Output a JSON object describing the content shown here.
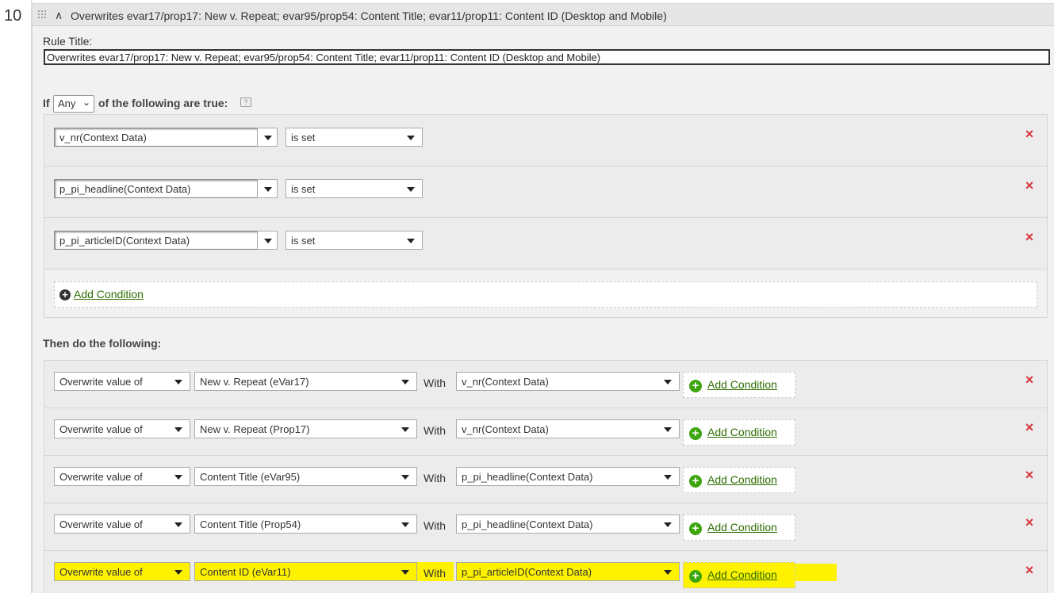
{
  "rule": {
    "number": "10",
    "header_title": "Overwrites evar17/prop17: New v. Repeat; evar95/prop54: Content Title; evar11/prop11: Content ID (Desktop and Mobile)",
    "title_label": "Rule Title:",
    "title_value": "Overwrites evar17/prop17: New v. Repeat; evar95/prop54: Content Title; evar11/prop11: Content ID (Desktop and Mobile)"
  },
  "conditions": {
    "if_prefix": "If",
    "match_mode": "Any",
    "if_suffix": "of the following are true:",
    "help_icon": "?",
    "rows": [
      {
        "variable": "v_nr(Context Data)",
        "operator": "is set"
      },
      {
        "variable": "p_pi_headline(Context Data)",
        "operator": "is set"
      },
      {
        "variable": "p_pi_articleID(Context Data)",
        "operator": "is set"
      }
    ],
    "add_condition_label": "Add Condition",
    "delete_icon": "×"
  },
  "actions": {
    "heading": "Then do the following:",
    "rows": [
      {
        "action": "Overwrite value of",
        "target": "New v. Repeat (eVar17)",
        "with_label": "With",
        "source": "v_nr(Context Data)",
        "add_condition_label": "Add Condition",
        "highlighted": false
      },
      {
        "action": "Overwrite value of",
        "target": "New v. Repeat (Prop17)",
        "with_label": "With",
        "source": "v_nr(Context Data)",
        "add_condition_label": "Add Condition",
        "highlighted": false
      },
      {
        "action": "Overwrite value of",
        "target": "Content Title (eVar95)",
        "with_label": "With",
        "source": "p_pi_headline(Context Data)",
        "add_condition_label": "Add Condition",
        "highlighted": false
      },
      {
        "action": "Overwrite value of",
        "target": "Content Title (Prop54)",
        "with_label": "With",
        "source": "p_pi_headline(Context Data)",
        "add_condition_label": "Add Condition",
        "highlighted": false
      },
      {
        "action": "Overwrite value of",
        "target": "Content ID (eVar11)",
        "with_label": "With",
        "source": "p_pi_articleID(Context Data)",
        "add_condition_label": "Add Condition",
        "highlighted": true
      }
    ]
  },
  "colors": {
    "highlight": "#fff200",
    "delete": "#d7373f",
    "link": "#2d6e00",
    "add_icon": "#3da50d"
  },
  "icons": {
    "drag": "drag-handle-icon",
    "collapse": "chevron-up-icon",
    "help": "help-icon",
    "delete": "close-icon",
    "add_dark": "plus-circle-icon",
    "add_green": "plus-circle-green-icon",
    "dropdown": "caret-down-icon"
  }
}
